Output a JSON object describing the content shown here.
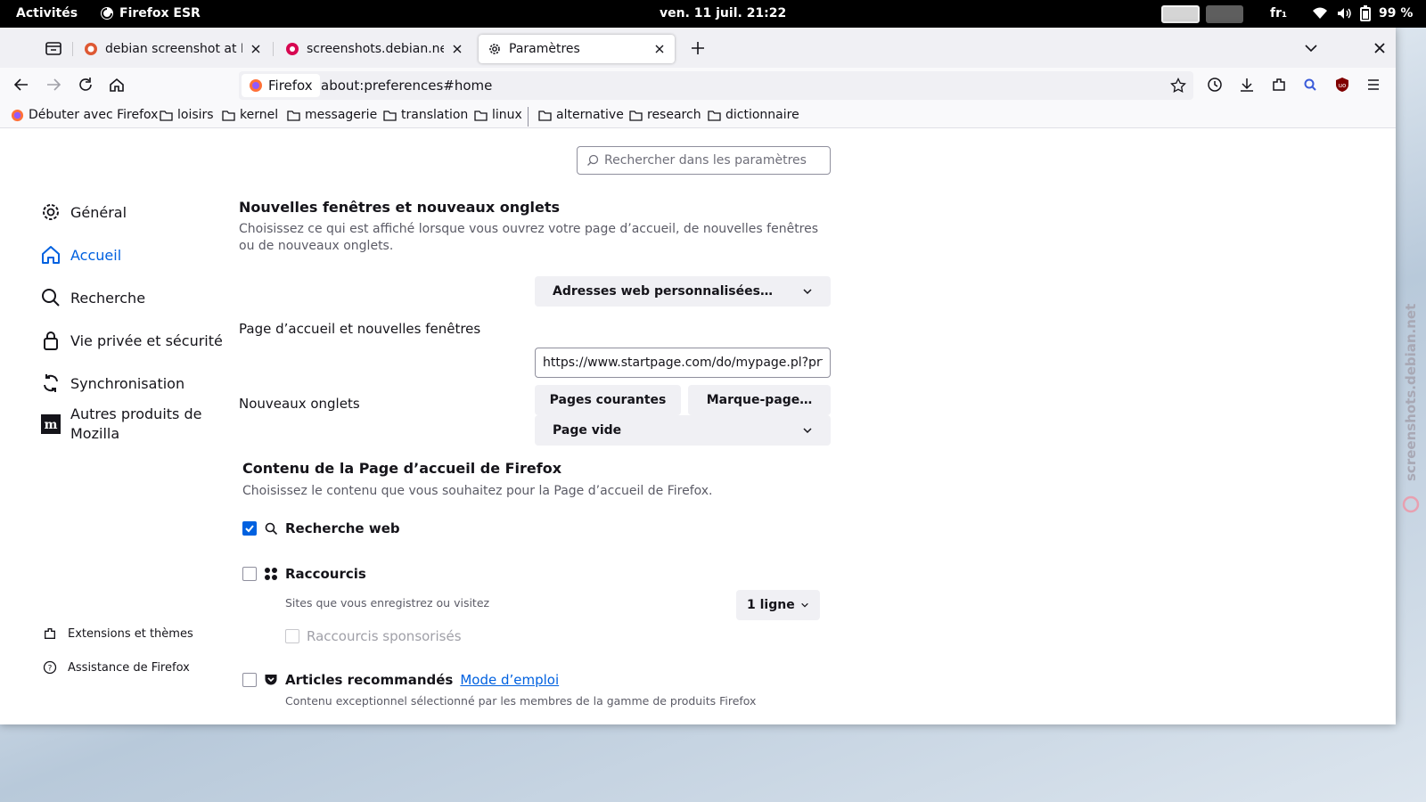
{
  "topbar": {
    "activities": "Activités",
    "app_name": "Firefox ESR",
    "clock": "ven. 11 juil.  21:22",
    "keyboard_layout": "fr₁",
    "battery": "99 %"
  },
  "tabs": [
    {
      "label": "debian screenshot at DuckDuckGo",
      "favicon": "duckduckgo-icon",
      "active": false
    },
    {
      "label": "screenshots.debian.net",
      "favicon": "debian-icon",
      "active": false
    },
    {
      "label": "Paramètres",
      "favicon": "gear-icon",
      "active": true
    }
  ],
  "navbar": {
    "identity_label": "Firefox",
    "url": "about:preferences#home"
  },
  "bookmarks": [
    {
      "label": "Débuter avec Firefox",
      "icon": "firefox-icon"
    },
    {
      "label": "loisirs",
      "icon": "folder-icon"
    },
    {
      "label": "kernel",
      "icon": "folder-icon"
    },
    {
      "label": "messagerie",
      "icon": "folder-icon"
    },
    {
      "label": "translation",
      "icon": "folder-icon"
    },
    {
      "label": "linux",
      "icon": "folder-icon"
    },
    {
      "label": "alternative",
      "icon": "folder-icon"
    },
    {
      "label": "research",
      "icon": "folder-icon"
    },
    {
      "label": "dictionnaire",
      "icon": "folder-icon"
    }
  ],
  "search": {
    "placeholder": "Rechercher dans les paramètres"
  },
  "categories": [
    {
      "label": "Général",
      "icon": "gear-icon",
      "selected": false
    },
    {
      "label": "Accueil",
      "icon": "home-icon",
      "selected": true
    },
    {
      "label": "Recherche",
      "icon": "search-icon",
      "selected": false
    },
    {
      "label": "Vie privée et sécurité",
      "icon": "lock-icon",
      "selected": false
    },
    {
      "label": "Synchronisation",
      "icon": "sync-icon",
      "selected": false
    },
    {
      "label": "Autres produits de Mozilla",
      "icon": "mozilla-icon",
      "selected": false
    }
  ],
  "footer_links": {
    "extensions": "Extensions et thèmes",
    "support": "Assistance de Firefox"
  },
  "new_windows": {
    "title": "Nouvelles fenêtres et nouveaux onglets",
    "description": "Choisissez ce qui est affiché lorsque vous ouvrez votre page d’accueil, de nouvelles fenêtres ou de nouveaux onglets.",
    "homepage_dropdown": "Adresses web personnalisées…",
    "homepage_label": "Page d’accueil et nouvelles fenêtres",
    "homepage_url": "https://www.startpage.com/do/mypage.pl?prfe",
    "current_pages_button": "Pages courantes",
    "bookmark_button": "Marque-page…",
    "newtabs_label": "Nouveaux onglets",
    "newtabs_dropdown": "Page vide"
  },
  "home_content": {
    "title": "Contenu de la Page d’accueil de Firefox",
    "description": "Choisissez le contenu que vous souhaitez pour la Page d’accueil de Firefox.",
    "web_search": {
      "label": "Recherche web",
      "checked": true
    },
    "shortcuts": {
      "label": "Raccourcis",
      "checked": false,
      "description": "Sites que vous enregistrez ou visitez",
      "rows_dropdown": "1 ligne"
    },
    "sponsored_shortcuts": {
      "label": "Raccourcis sponsorisés",
      "checked": false
    },
    "recommended": {
      "label": "Articles recommandés",
      "checked": false,
      "link": "Mode d’emploi",
      "description": "Contenu exceptionnel sélectionné par les membres de la gamme de produits Firefox"
    }
  },
  "watermark": "screenshots.debian.net"
}
